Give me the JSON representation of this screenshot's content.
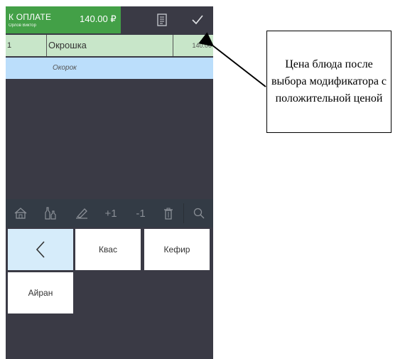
{
  "header": {
    "pay_label": "К ОПЛАТЕ",
    "waiter_name": "Орлов Виктор",
    "total": "140.00 ₽",
    "icons": [
      "receipt-icon",
      "check-icon"
    ]
  },
  "order": {
    "items": [
      {
        "qty": "1",
        "name": "Окрошка",
        "price": "140.00",
        "modifier": "Окорок"
      }
    ]
  },
  "toolbar": {
    "buttons": [
      "home-icon",
      "bottles-icon",
      "edit-icon",
      "+1",
      "-1",
      "trash-icon",
      "search-icon"
    ]
  },
  "tiles": {
    "back_icon": "chevron-left-icon",
    "items": [
      "Квас",
      "Кефир",
      "Айран"
    ]
  },
  "annotation": {
    "text": "Цена блюда после выбора модификатора с положительной ценой"
  },
  "colors": {
    "screen_bg": "#3a3a45",
    "pay_green": "#43a047",
    "order_row": "#c8e6c9",
    "modifier_row": "#bbdefb",
    "back_tile": "#d6ecfa"
  }
}
